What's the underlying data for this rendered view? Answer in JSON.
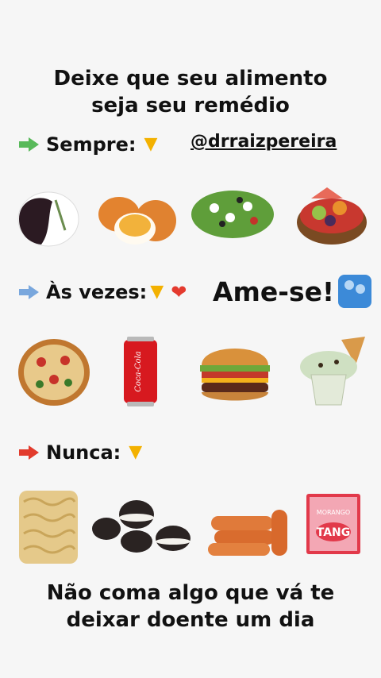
{
  "title": {
    "line1": "Deixe que seu alimento",
    "line2": "seja seu remédio"
  },
  "rows": {
    "sempre": {
      "label": "Sempre:",
      "icon": "green-right-arrow-icon",
      "arrow_color": "#58b95a"
    },
    "as_vezes": {
      "label": "Às vezes:",
      "icon": "blue-right-arrow-icon",
      "arrow_color": "#79a7dd"
    },
    "nunca": {
      "label": "Nunca:",
      "icon": "red-right-arrow-icon",
      "arrow_color": "#e23b2c"
    }
  },
  "handle": "@drraizpereira",
  "ame_se": "Ame-se!",
  "bottom": {
    "line1": "Não coma algo que vá te",
    "line2": "deixar doente um dia"
  },
  "foods": {
    "sempre": [
      "black-rice-icon",
      "boiled-eggs-icon",
      "salad-icon",
      "fruit-bowl-icon"
    ],
    "as_vezes": [
      "pizza-icon",
      "coca-cola-can-icon",
      "burger-icon",
      "ice-cream-icon"
    ],
    "nunca": [
      "instant-noodles-icon",
      "oreo-cookies-icon",
      "sausages-icon",
      "tang-juice-packet-icon"
    ]
  },
  "can_text": "Coca-Cola",
  "tang_text": "TANG",
  "tang_flavor": "MORANGO"
}
